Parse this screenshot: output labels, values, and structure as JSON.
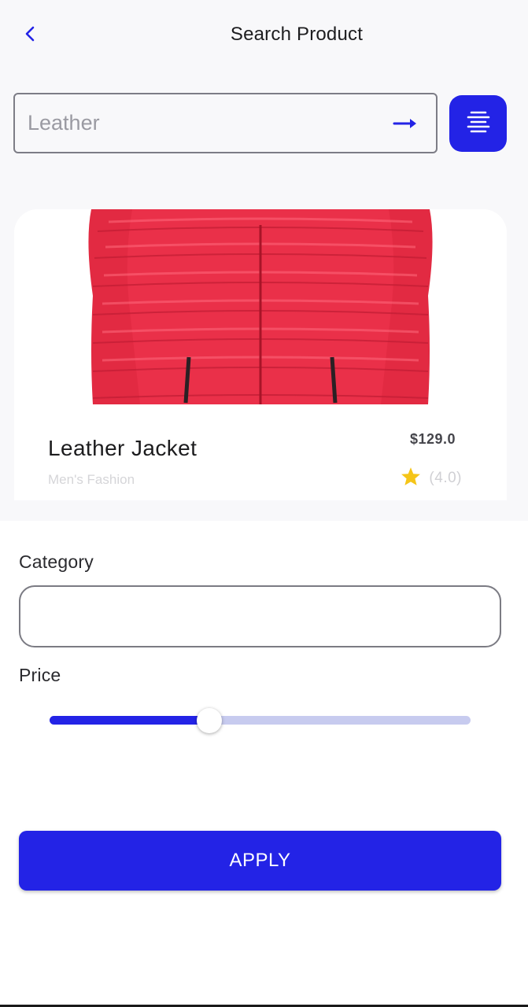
{
  "header": {
    "title": "Search Product",
    "back_icon": "chevron-left-icon"
  },
  "search": {
    "placeholder": "Leather",
    "value": "",
    "submit_icon": "arrow-right-icon",
    "filter_icon": "align-center-icon"
  },
  "product": {
    "name": "Leather Jacket",
    "category": "Men's Fashion",
    "price": "$129.0",
    "rating_label": "(4.0)",
    "rating_icon": "star-icon",
    "image_description": "red puffer jacket"
  },
  "filters": {
    "category_label": "Category",
    "category_value": "",
    "price_label": "Price",
    "price_fraction": 0.38,
    "apply_label": "APPLY"
  },
  "colors": {
    "accent": "#2323e6",
    "slider_track": "#c7cbef",
    "star": "#f5c518",
    "jacket_red": "#e52a44"
  }
}
